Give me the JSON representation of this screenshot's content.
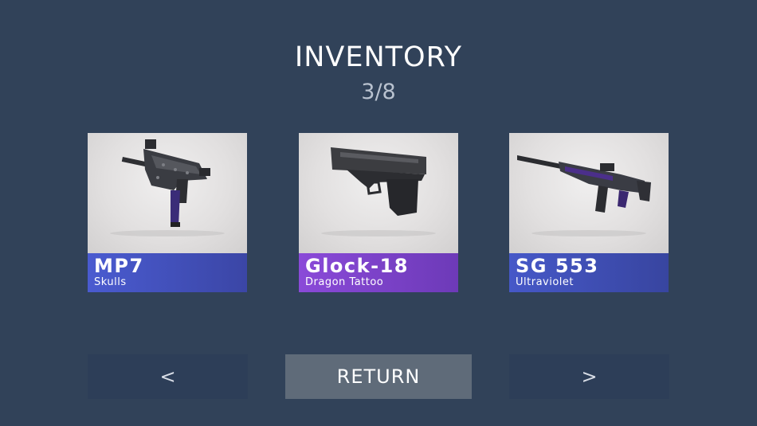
{
  "header": {
    "title": "INVENTORY",
    "counter": "3/8"
  },
  "items": [
    {
      "name": "MP7",
      "skin": "Skulls",
      "icon": "mp7-smg-icon",
      "accent": "#4a5bd0"
    },
    {
      "name": "Glock-18",
      "skin": "Dragon Tattoo",
      "icon": "glock-pistol-icon",
      "accent": "#8a4ad8"
    },
    {
      "name": "SG 553",
      "skin": "Ultraviolet",
      "icon": "sg553-rifle-icon",
      "accent": "#4658c8"
    }
  ],
  "controls": {
    "prev_label": "<",
    "return_label": "RETURN",
    "next_label": ">"
  },
  "colors": {
    "background": "#314259",
    "return_button": "#5f6b79",
    "nav_button": "#2d3e58"
  }
}
